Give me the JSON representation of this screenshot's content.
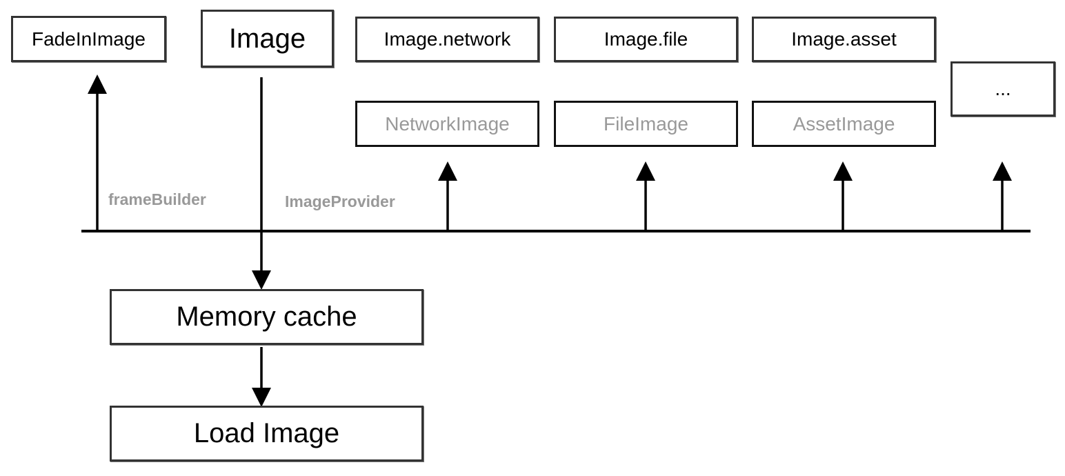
{
  "widgets": {
    "fade_in_image": "FadeInImage",
    "image": "Image",
    "image_network": "Image.network",
    "image_file": "Image.file",
    "image_asset": "Image.asset",
    "more": "..."
  },
  "providers": {
    "network_image": "NetworkImage",
    "file_image": "FileImage",
    "asset_image": "AssetImage"
  },
  "labels": {
    "frame_builder": "frameBuilder",
    "image_provider": "ImageProvider"
  },
  "pipeline": {
    "memory_cache": "Memory cache",
    "load_image": "Load Image"
  },
  "colors": {
    "line": "#000000",
    "muted_text": "#999999"
  }
}
